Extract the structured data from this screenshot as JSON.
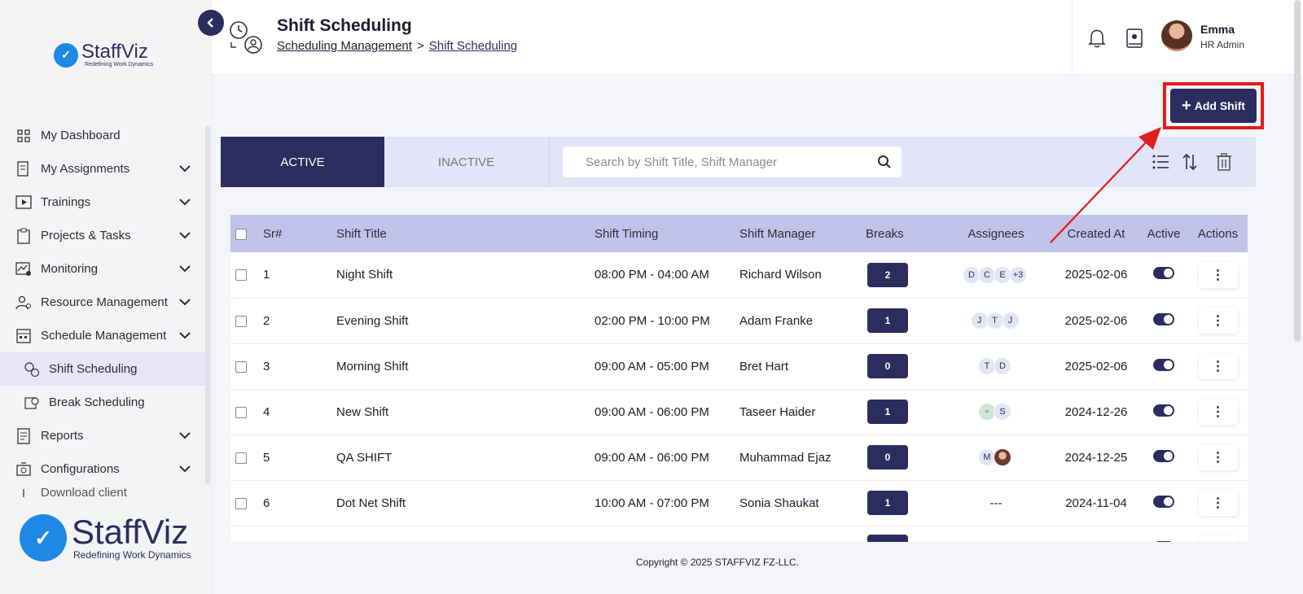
{
  "sidebar": {
    "brand": {
      "name": "StaffViz",
      "tagline": "Redefining Work Dynamics"
    },
    "items": [
      {
        "label": "My Dashboard",
        "icon": "dashboard-icon",
        "expandable": false
      },
      {
        "label": "My Assignments",
        "icon": "assignments-icon",
        "expandable": true
      },
      {
        "label": "Trainings",
        "icon": "play-icon",
        "expandable": true
      },
      {
        "label": "Projects & Tasks",
        "icon": "clipboard-icon",
        "expandable": true
      },
      {
        "label": "Monitoring",
        "icon": "monitoring-icon",
        "expandable": true
      },
      {
        "label": "Resource Management",
        "icon": "resource-icon",
        "expandable": true
      },
      {
        "label": "Schedule Management",
        "icon": "schedule-icon",
        "expandable": true
      },
      {
        "label": "Shift Scheduling",
        "icon": "shift-icon",
        "active": true
      },
      {
        "label": "Break Scheduling",
        "icon": "break-icon"
      },
      {
        "label": "Reports",
        "icon": "reports-icon",
        "expandable": true
      },
      {
        "label": "Configurations",
        "icon": "config-icon",
        "expandable": true
      },
      {
        "label": "Download client",
        "icon": "download-icon"
      }
    ]
  },
  "header": {
    "title": "Shift Scheduling",
    "breadcrumb": {
      "parent": "Scheduling Management",
      "separator": ">",
      "current": "Shift Scheduling"
    },
    "user": {
      "name": "Emma",
      "role": "HR Admin"
    }
  },
  "add_button": {
    "label": "Add Shift"
  },
  "tabs": {
    "active": "ACTIVE",
    "inactive": "INACTIVE"
  },
  "search": {
    "placeholder": "Search by Shift Title, Shift Manager"
  },
  "table": {
    "headers": {
      "sr": "Sr#",
      "title": "Shift Title",
      "timing": "Shift Timing",
      "manager": "Shift Manager",
      "breaks": "Breaks",
      "assignees": "Assignees",
      "created": "Created At",
      "active": "Active",
      "actions": "Actions"
    },
    "rows": [
      {
        "sr": "1",
        "title": "Night Shift",
        "timing": "08:00 PM - 04:00 AM",
        "manager": "Richard Wilson",
        "breaks": "2",
        "assignees": [
          "D",
          "C",
          "E",
          "+3"
        ],
        "created": "2025-02-06",
        "active": true
      },
      {
        "sr": "2",
        "title": "Evening Shift",
        "timing": "02:00 PM - 10:00 PM",
        "manager": "Adam Franke",
        "breaks": "1",
        "assignees": [
          "J",
          "T",
          "J"
        ],
        "created": "2025-02-06",
        "active": true
      },
      {
        "sr": "3",
        "title": "Morning Shift",
        "timing": "09:00 AM - 05:00 PM",
        "manager": "Bret Hart",
        "breaks": "0",
        "assignees": [
          "T",
          "D"
        ],
        "created": "2025-02-06",
        "active": true
      },
      {
        "sr": "4",
        "title": "New Shift",
        "timing": "09:00 AM - 06:00 PM",
        "manager": "Taseer Haider",
        "breaks": "1",
        "assignees": [
          "[pic]",
          "S"
        ],
        "created": "2024-12-26",
        "active": true
      },
      {
        "sr": "5",
        "title": "QA SHIFT",
        "timing": "09:00 AM - 06:00 PM",
        "manager": "Muhammad Ejaz",
        "breaks": "0",
        "assignees": [
          "M",
          "[img]"
        ],
        "created": "2024-12-25",
        "active": true
      },
      {
        "sr": "6",
        "title": "Dot Net Shift",
        "timing": "10:00 AM - 07:00 PM",
        "manager": "Sonia Shaukat",
        "breaks": "1",
        "assignees": [],
        "empty_assignees": "---",
        "created": "2024-11-04",
        "active": true
      },
      {
        "sr": "",
        "title": "",
        "timing": "",
        "manager": "",
        "breaks": "",
        "assignees": [],
        "created": "",
        "active": true
      }
    ]
  },
  "footer": {
    "copyright": "Copyright © 2025 STAFFVIZ FZ-LLC."
  },
  "colors": {
    "primary": "#2b2d5e",
    "header_row": "#c2c3ea",
    "toolbar": "#e4e4f8",
    "highlight": "#e31c1c"
  }
}
